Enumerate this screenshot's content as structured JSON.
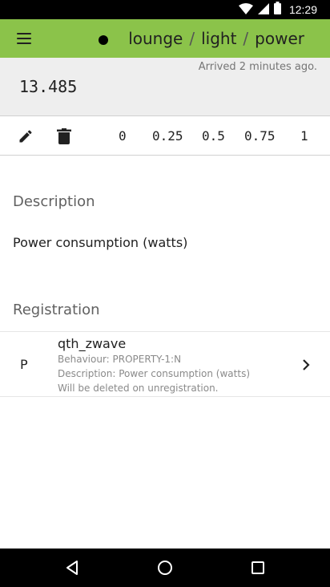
{
  "status_bar": {
    "time": "12:29"
  },
  "app_bar": {
    "breadcrumb": [
      "lounge",
      "light",
      "power"
    ],
    "separator": "/"
  },
  "value_panel": {
    "arrived": "Arrived 2 minutes ago.",
    "value": "13.485"
  },
  "toolbar": {
    "scale": [
      "0",
      "0.25",
      "0.5",
      "0.75",
      "1"
    ]
  },
  "description": {
    "title": "Description",
    "text": "Power consumption (watts)"
  },
  "registration": {
    "title": "Registration",
    "item": {
      "letter": "P",
      "name": "qth_zwave",
      "behaviour": "Behaviour: PROPERTY-1:N",
      "description": "Description: Power consumption (watts)",
      "note": "Will be deleted on unregistration."
    }
  },
  "colors": {
    "app_bar": "#8bc34a",
    "value_panel": "#eeeeee"
  }
}
